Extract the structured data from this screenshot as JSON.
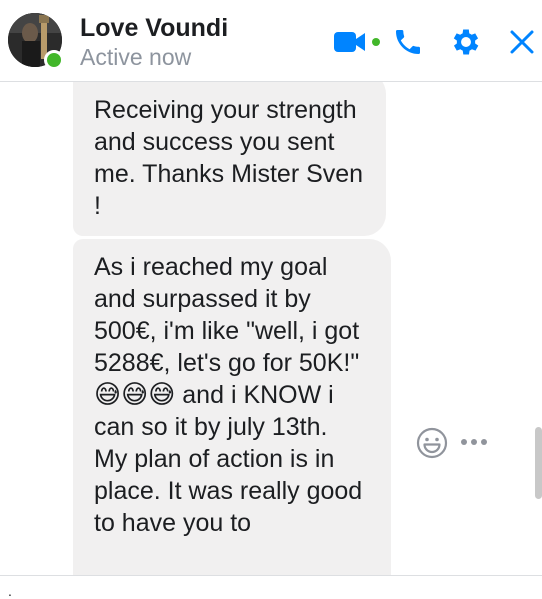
{
  "header": {
    "contact_name": "Love Voundi",
    "status": "Active now",
    "icons": [
      "video-call-icon",
      "phone-icon",
      "gear-icon",
      "close-icon"
    ],
    "accent_color": "#0084ff",
    "presence_color": "#42b72a"
  },
  "messages": [
    {
      "text": "Receiving your strength and success you sent me. Thanks Mister Sven !"
    },
    {
      "part1": "As i reached my goal and surpassed it by 500€, i'm like \"well, i got 5288€, let's go for 50K!\"",
      "emojis": "😅😅😅",
      "part2": "and i KNOW i can so it by july 13th.",
      "part3": "My plan of action is in place. It was really good to have you to"
    }
  ],
  "message_actions": [
    "react-emoji-icon",
    "more-options-icon"
  ],
  "footer": {
    "text": "."
  }
}
